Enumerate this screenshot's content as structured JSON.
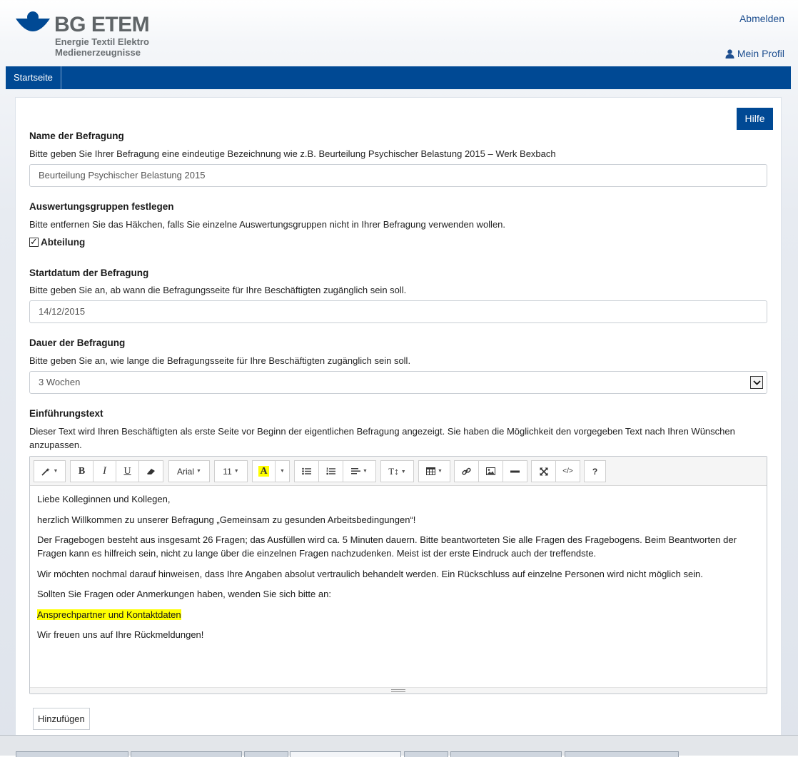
{
  "header": {
    "brand": "BG ETEM",
    "tagline_line1": "Energie Textil Elektro",
    "tagline_line2": "Medienerzeugnisse",
    "logout": "Abmelden",
    "profile": "Mein Profil",
    "brand_color": "#004994"
  },
  "nav": {
    "items": [
      {
        "label": "Startseite"
      }
    ]
  },
  "form": {
    "help_button": "Hilfe",
    "name": {
      "label": "Name der Befragung",
      "hint": "Bitte geben Sie Ihrer Befragung eine eindeutige Bezeichnung wie z.B. Beurteilung Psychischer Belastung 2015 – Werk Bexbach",
      "value": "Beurteilung Psychischer Belastung 2015"
    },
    "groups": {
      "label": "Auswertungsgruppen festlegen",
      "hint": "Bitte entfernen Sie das Häkchen, falls Sie einzelne Auswertungsgruppen nicht in Ihrer Befragung verwenden wollen.",
      "checkbox_label": "Abteilung",
      "checked": true
    },
    "start": {
      "label": "Startdatum der Befragung",
      "hint": "Bitte geben Sie an, ab wann die Befragungsseite für Ihre Beschäftigten zugänglich sein soll.",
      "value": "14/12/2015"
    },
    "duration": {
      "label": "Dauer der Befragung",
      "hint": "Bitte geben Sie an, wie lange die Befragungsseite für Ihre Beschäftigten zugänglich sein soll.",
      "selected": "3 Wochen"
    },
    "intro": {
      "label": "Einführungstext",
      "hint": "Dieser Text wird Ihren Beschäftigten als erste Seite vor Beginn der eigentlichen Befragung angezeigt. Sie haben die Möglichkeit den vorgegeben Text nach Ihren Wünschen anzupassen."
    },
    "add_button": "Hinzufügen"
  },
  "editor": {
    "toolbar": {
      "font_family": "Arial",
      "font_size": "11",
      "help": "?",
      "icons": [
        "magic-style-icon",
        "bold-icon",
        "italic-icon",
        "underline-icon",
        "eraser-icon",
        "font-color-icon",
        "unordered-list-icon",
        "ordered-list-icon",
        "paragraph-align-icon",
        "line-height-icon",
        "table-icon",
        "link-icon",
        "picture-icon",
        "horizontal-rule-icon",
        "fullscreen-icon",
        "code-view-icon",
        "help-icon"
      ],
      "highlight_color": "#ffff00"
    },
    "paragraphs": [
      "Liebe Kolleginnen und Kollegen,",
      "herzlich Willkommen zu unserer Befragung „Gemeinsam zu gesunden Arbeitsbedingungen“!",
      "Der Fragebogen besteht aus insgesamt 26 Fragen; das Ausfüllen wird ca. 5 Minuten dauern. Bitte beantworteten Sie alle Fragen des Fragebogens. Beim Beantworten der Fragen kann es hilfreich sein, nicht zu lange über die einzelnen Fragen nachzudenken. Meist ist der erste Eindruck auch der treffendste.",
      "Wir möchten nochmal darauf hinweisen, dass Ihre Angaben absolut vertraulich behandelt werden. Ein Rückschluss auf einzelne Personen wird nicht möglich sein.",
      "Sollten Sie Fragen oder Anmerkungen haben, wenden Sie sich bitte an:",
      "Ansprechpartner und Kontaktdaten",
      "Wir freuen uns auf Ihre Rückmeldungen!"
    ]
  }
}
